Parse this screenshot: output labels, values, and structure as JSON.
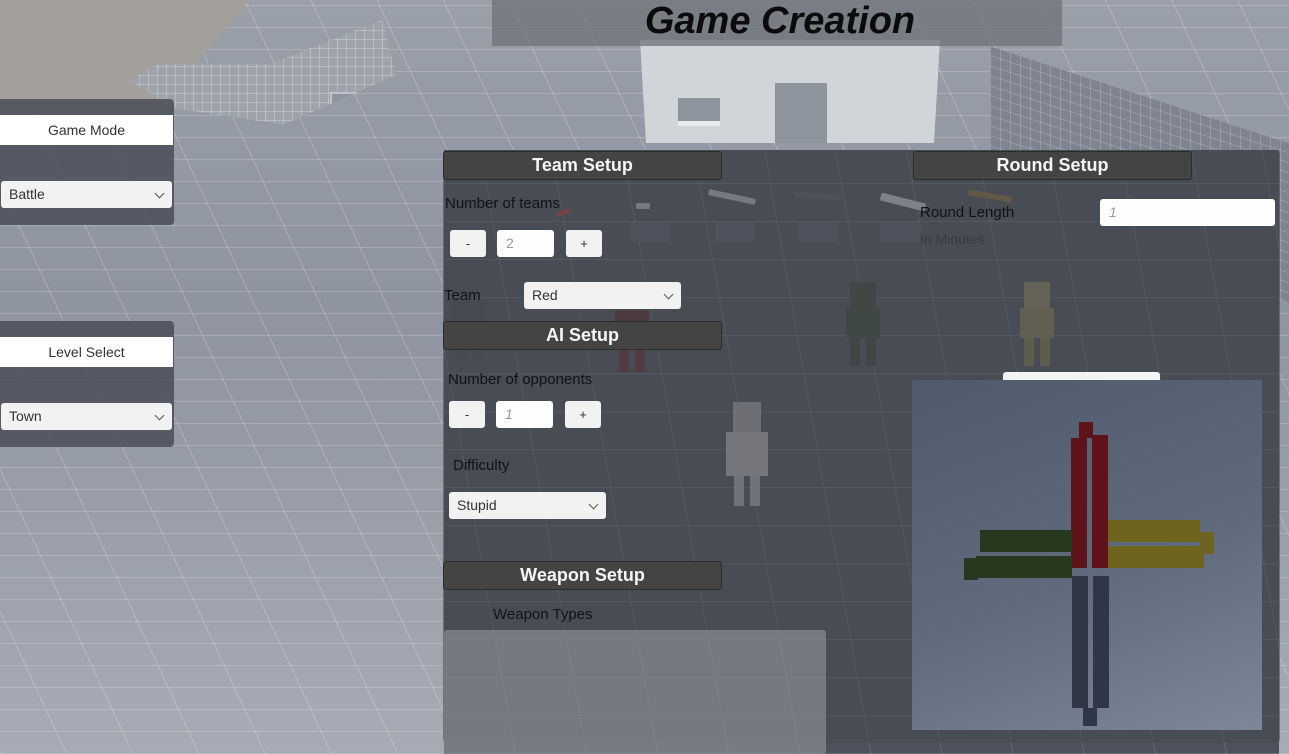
{
  "title": "Game Creation",
  "game_mode": {
    "header": "Game Mode",
    "selected": "Battle"
  },
  "level_select": {
    "header": "Level Select",
    "selected": "Town"
  },
  "team_setup": {
    "header": "Team Setup",
    "number_of_teams_label": "Number of teams",
    "decrement_label": "-",
    "increment_label": "+",
    "number_of_teams_placeholder": "2",
    "team_label": "Team",
    "team_selected": "Red"
  },
  "ai_setup": {
    "header": "AI Setup",
    "number_of_opponents_label": "Number of opponents",
    "decrement_label": "-",
    "increment_label": "+",
    "number_of_opponents_placeholder": "1",
    "difficulty_label": "Difficulty",
    "difficulty_selected": "Stupid"
  },
  "round_setup": {
    "header": "Round Setup",
    "round_length_label": "Round Length",
    "round_length_placeholder": "1",
    "units_label": "In Minutes"
  },
  "weapon_setup": {
    "header": "Weapon Setup",
    "weapon_types_label": "Weapon Types",
    "weapon_types": []
  },
  "spawn_preview": {
    "team_colors": {
      "red": "#5e1219",
      "green": "#26391f",
      "yellow": "#6e6420",
      "blue": "#2f3747"
    }
  }
}
